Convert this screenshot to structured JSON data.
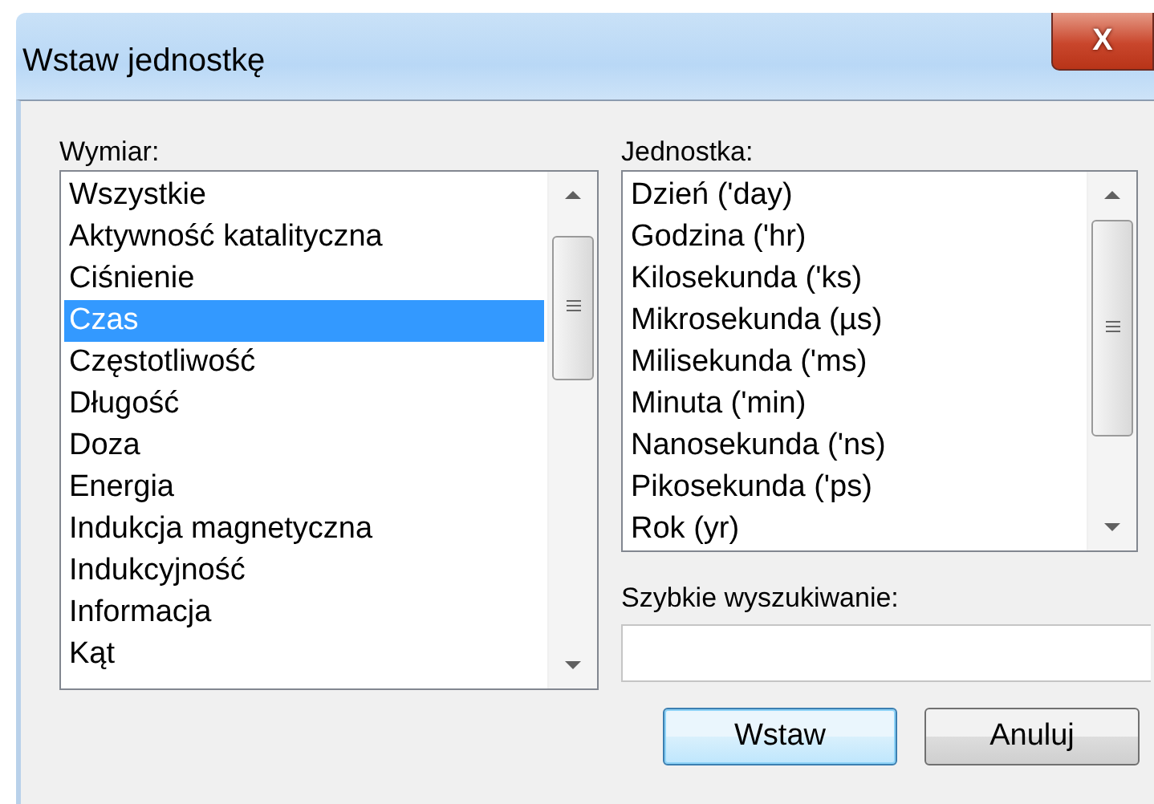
{
  "window": {
    "title": "Wstaw jednostkę",
    "close": "X"
  },
  "dimension": {
    "label": "Wymiar:",
    "items": [
      {
        "text": "Wszystkie",
        "selected": false
      },
      {
        "text": "Aktywność katalityczna",
        "selected": false
      },
      {
        "text": "Ciśnienie",
        "selected": false
      },
      {
        "text": "Czas",
        "selected": true
      },
      {
        "text": "Częstotliwość",
        "selected": false
      },
      {
        "text": "Długość",
        "selected": false
      },
      {
        "text": "Doza",
        "selected": false
      },
      {
        "text": "Energia",
        "selected": false
      },
      {
        "text": "Indukcja magnetyczna",
        "selected": false
      },
      {
        "text": "Indukcyjność",
        "selected": false
      },
      {
        "text": "Informacja",
        "selected": false
      },
      {
        "text": "Kąt",
        "selected": false
      }
    ]
  },
  "unit": {
    "label": "Jednostka:",
    "items": [
      {
        "text": "Dzień ('day)",
        "selected": false
      },
      {
        "text": "Godzina ('hr)",
        "selected": false
      },
      {
        "text": "Kilosekunda ('ks)",
        "selected": false
      },
      {
        "text": "Mikrosekunda (µs)",
        "selected": false
      },
      {
        "text": "Milisekunda ('ms)",
        "selected": false
      },
      {
        "text": "Minuta ('min)",
        "selected": false
      },
      {
        "text": "Nanosekunda ('ns)",
        "selected": false
      },
      {
        "text": "Pikosekunda ('ps)",
        "selected": false
      },
      {
        "text": "Rok (yr)",
        "selected": false
      }
    ]
  },
  "quick_search": {
    "label": "Szybkie wyszukiwanie:"
  },
  "buttons": [
    {
      "label": "Wstaw",
      "focused": true
    },
    {
      "label": "Anuluj",
      "focused": false
    }
  ]
}
